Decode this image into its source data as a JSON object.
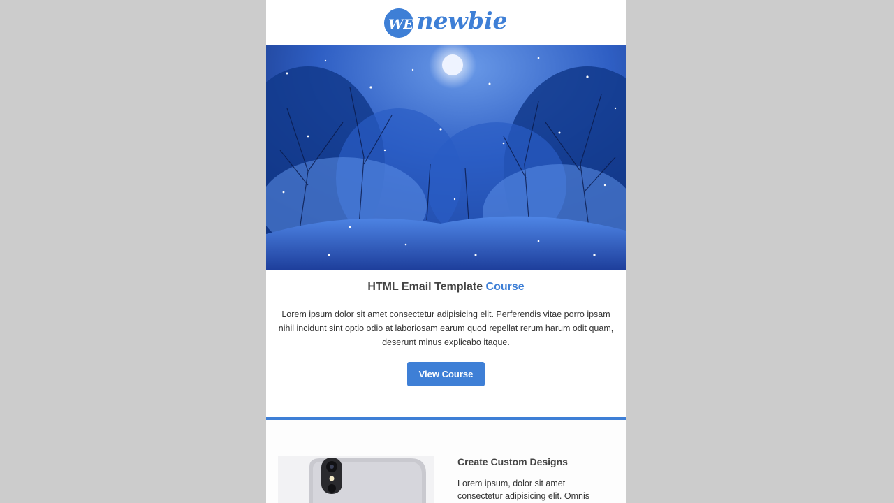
{
  "logo": {
    "mark_text": "WE",
    "word": "newbie"
  },
  "hero": {
    "alt": "Snowy forest at night under a full moon"
  },
  "course": {
    "title_prefix": "HTML Email Template",
    "title_accent": "Course",
    "description": "Lorem ipsum dolor sit amet consectetur adipisicing elit. Perferendis vitae porro ipsam nihil incidunt sint optio odio at laboriosam earum quod repellat rerum harum odit quam, deserunt minus explicabo itaque.",
    "button_label": "View Course"
  },
  "feature": {
    "title": "Create Custom Designs",
    "text": "Lorem ipsum, dolor sit amet consectetur adipisicing elit. Omnis"
  },
  "colors": {
    "accent": "#3e7fd6",
    "page_background": "#cccccc",
    "email_background": "#ffffff"
  }
}
